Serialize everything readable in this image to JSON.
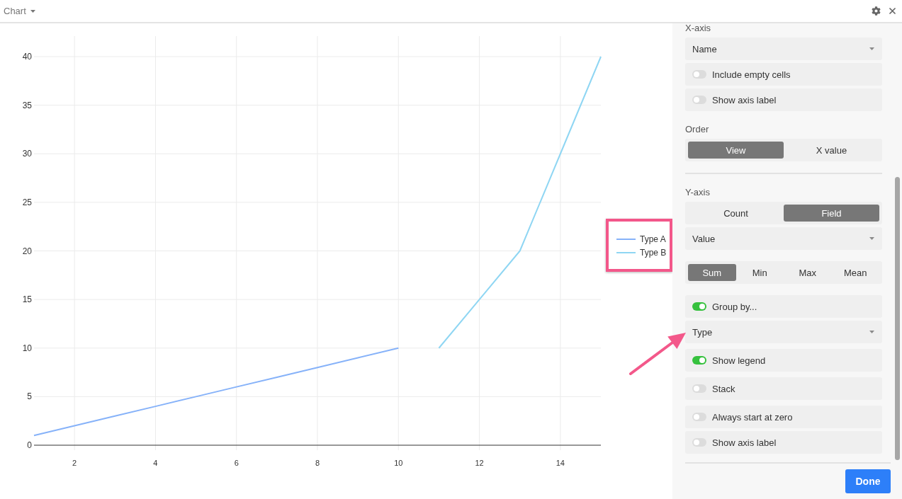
{
  "header": {
    "title": "Chart"
  },
  "chart": {
    "chart_data": {
      "type": "line",
      "x": [
        1,
        2,
        3,
        4,
        5,
        6,
        7,
        8,
        9,
        10,
        11,
        12,
        13,
        14,
        15
      ],
      "series": [
        {
          "name": "Type A",
          "color": "#86b2f9",
          "values": [
            1,
            2,
            3,
            4,
            5,
            6,
            7,
            8,
            9,
            10,
            null,
            null,
            null,
            null,
            null
          ]
        },
        {
          "name": "Type B",
          "color": "#8fd6f3",
          "values": [
            null,
            null,
            null,
            null,
            null,
            null,
            null,
            null,
            null,
            null,
            10,
            15,
            20,
            30,
            40
          ]
        }
      ],
      "xlim": [
        1,
        15
      ],
      "ylim": [
        0,
        40
      ],
      "xticks": [
        2,
        4,
        6,
        8,
        10,
        12,
        14
      ],
      "yticks": [
        0,
        5,
        10,
        15,
        20,
        25,
        30,
        35,
        40
      ],
      "grid": true,
      "legend": true
    }
  },
  "panel": {
    "blocks": [
      {
        "sections": [
          {
            "title": "X-axis",
            "groups": [
              {
                "controls": [
                  {
                    "kind": "dropdown",
                    "value": "Name"
                  },
                  {
                    "kind": "toggle",
                    "label": "Include empty cells",
                    "on": false
                  },
                  {
                    "kind": "toggle",
                    "label": "Show axis label",
                    "on": false
                  }
                ]
              }
            ]
          },
          {
            "title": "Order",
            "groups": [
              {
                "controls": [
                  {
                    "kind": "segmented",
                    "options": [
                      {
                        "label": "View",
                        "selected": true
                      },
                      {
                        "label": "X value",
                        "selected": false
                      }
                    ]
                  }
                ]
              }
            ]
          }
        ]
      },
      {
        "sections": [
          {
            "title": "Y-axis",
            "groups": [
              {
                "controls": [
                  {
                    "kind": "segmented",
                    "options": [
                      {
                        "label": "Count",
                        "selected": false
                      },
                      {
                        "label": "Field",
                        "selected": true
                      }
                    ]
                  },
                  {
                    "kind": "dropdown",
                    "value": "Value"
                  }
                ]
              },
              {
                "controls": [
                  {
                    "kind": "segmented",
                    "options": [
                      {
                        "label": "Sum",
                        "selected": true
                      },
                      {
                        "label": "Min",
                        "selected": false
                      },
                      {
                        "label": "Max",
                        "selected": false
                      },
                      {
                        "label": "Mean",
                        "selected": false
                      }
                    ]
                  }
                ]
              },
              {
                "controls": [
                  {
                    "kind": "toggle",
                    "label": "Group by...",
                    "on": true
                  },
                  {
                    "kind": "dropdown",
                    "value": "Type"
                  }
                ]
              },
              {
                "controls": [
                  {
                    "kind": "toggle",
                    "label": "Show legend",
                    "on": true
                  }
                ]
              },
              {
                "controls": [
                  {
                    "kind": "toggle",
                    "label": "Stack",
                    "on": false
                  }
                ]
              },
              {
                "controls": [
                  {
                    "kind": "toggle",
                    "label": "Always start at zero",
                    "on": false
                  },
                  {
                    "kind": "toggle",
                    "label": "Show axis label",
                    "on": false
                  }
                ]
              }
            ]
          }
        ]
      }
    ],
    "done_button": {
      "label": "Done"
    }
  }
}
